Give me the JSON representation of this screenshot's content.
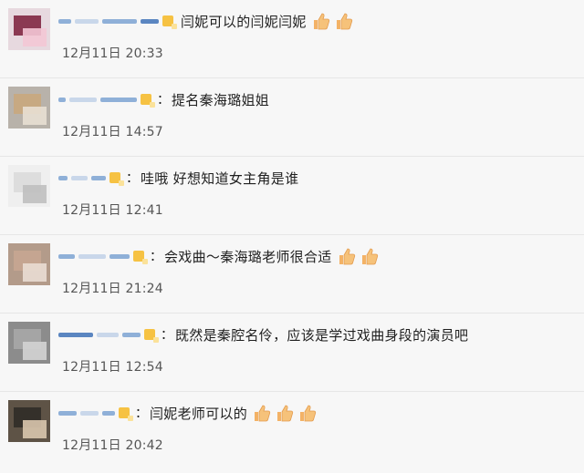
{
  "comments": [
    {
      "text": "闫妮可以的闫妮闫妮",
      "colon": "",
      "thumbs": 2,
      "time": "12月11日 20:33",
      "avatar_colors": [
        "#7a1c3a",
        "#f3c7d5",
        "#e7d9df"
      ]
    },
    {
      "text": "提名秦海璐姐姐",
      "colon": "：",
      "thumbs": 0,
      "time": "12月11日 14:57",
      "avatar_colors": [
        "#c9a77b",
        "#e8dfd3",
        "#b8b2aa"
      ]
    },
    {
      "text": "哇哦 好想知道女主角是谁",
      "colon": "：",
      "thumbs": 0,
      "time": "12月11日 12:41",
      "avatar_colors": [
        "#d9d9d9",
        "#bfbfbf",
        "#efefef"
      ]
    },
    {
      "text": "会戏曲～秦海璐老师很合适",
      "colon": "：",
      "thumbs": 2,
      "time": "12月11日 21:24",
      "avatar_colors": [
        "#c8a792",
        "#e9ddd3",
        "#b39b8a"
      ]
    },
    {
      "text": "既然是秦腔名伶，应该是学过戏曲身段的演员吧",
      "colon": "：",
      "thumbs": 0,
      "time": "12月11日 12:54",
      "avatar_colors": [
        "#a9a9a9",
        "#d3d3d3",
        "#8c8c8c"
      ]
    },
    {
      "text": "闫妮老师可以的",
      "colon": "：",
      "thumbs": 3,
      "time": "12月11日 20:42",
      "avatar_colors": [
        "#2d2a26",
        "#d9c7ad",
        "#5e5346"
      ]
    }
  ],
  "icons": {
    "thumb": "thumbs-up-emoji",
    "badge": "vip-badge"
  },
  "colors": {
    "background": "#f7f7f7",
    "divider": "#e6e6e6",
    "username_blur": "#5b86c1",
    "badge": "#f6c243"
  }
}
